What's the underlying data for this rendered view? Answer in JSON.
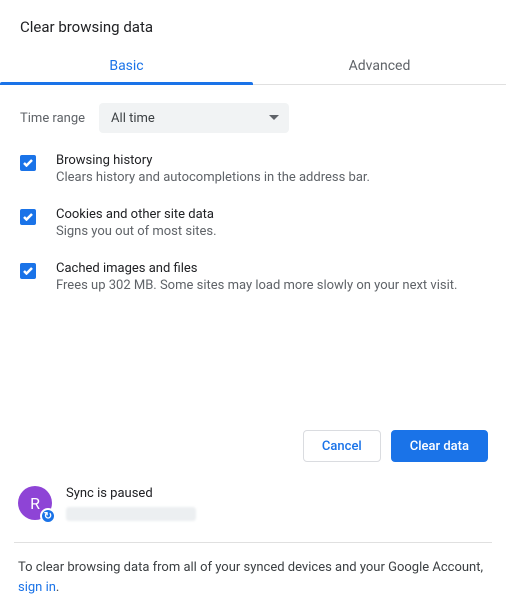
{
  "title": "Clear browsing data",
  "tabs": {
    "basic": "Basic",
    "advanced": "Advanced"
  },
  "time_range": {
    "label": "Time range",
    "value": "All time"
  },
  "options": [
    {
      "label": "Browsing history",
      "desc": "Clears history and autocompletions in the address bar."
    },
    {
      "label": "Cookies and other site data",
      "desc": "Signs you out of most sites."
    },
    {
      "label": "Cached images and files",
      "desc": "Frees up 302 MB. Some sites may load more slowly on your next visit."
    }
  ],
  "actions": {
    "cancel": "Cancel",
    "clear": "Clear data"
  },
  "sync": {
    "avatar_letter": "R",
    "status": "Sync is paused"
  },
  "footer": {
    "text": "To clear browsing data from all of your synced devices and your Google Account, ",
    "link": "sign in",
    "suffix": "."
  }
}
